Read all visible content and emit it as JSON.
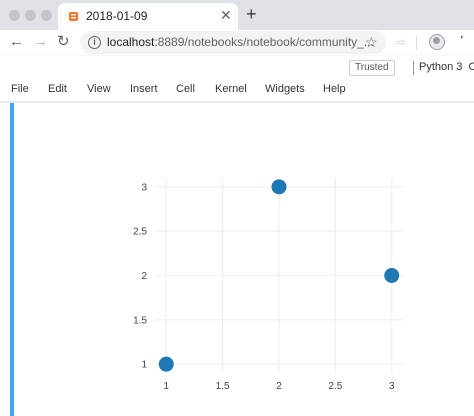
{
  "browser": {
    "tab": {
      "title": "2018-01-09"
    },
    "new_tab": "+",
    "back": "←",
    "forward": "→",
    "reload": "↻",
    "close_tab": "✕",
    "address": {
      "host": "localhost",
      "rest": ":8889/notebooks/notebook/community_..."
    },
    "star": "☆",
    "extension": "⇨"
  },
  "notebook": {
    "trusted_label": "Trusted",
    "kernel_label": "Python 3",
    "kernel_extra": "O",
    "menu": [
      "File",
      "Edit",
      "View",
      "Insert",
      "Cell",
      "Kernel",
      "Widgets",
      "Help"
    ]
  },
  "colors": {
    "marker": "#1f77b4",
    "cell_bar": "#42a5f5",
    "grid": "#eeeeee"
  },
  "chart_data": {
    "type": "scatter",
    "x": [
      1,
      2,
      3
    ],
    "y": [
      1,
      3,
      2
    ],
    "xlim": [
      0.9,
      3.1
    ],
    "ylim": [
      0.9,
      3.1
    ],
    "xticks": [
      "1",
      "1.5",
      "2",
      "2.5",
      "3"
    ],
    "yticks": [
      "1",
      "1.5",
      "2",
      "2.5",
      "3"
    ],
    "grid": true
  }
}
